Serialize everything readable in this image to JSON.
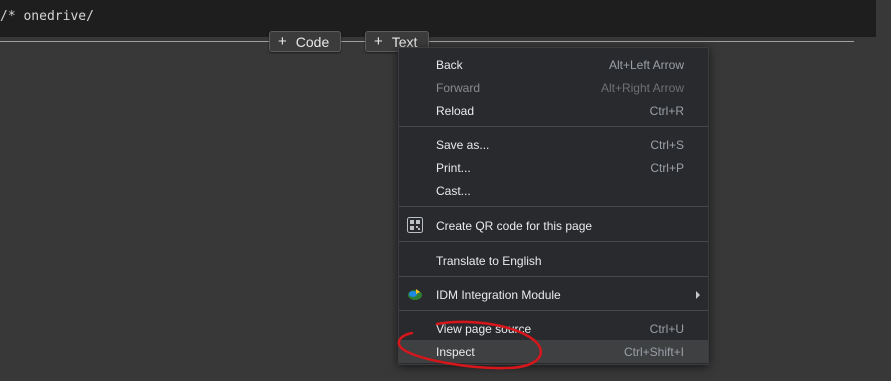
{
  "code_cell": {
    "text": "/* onedrive/"
  },
  "add_cell": {
    "code_label": "Code",
    "text_label": "Text",
    "plus_symbol": "+"
  },
  "context_menu": {
    "back": {
      "label": "Back",
      "shortcut": "Alt+Left Arrow"
    },
    "forward": {
      "label": "Forward",
      "shortcut": "Alt+Right Arrow",
      "disabled": true
    },
    "reload": {
      "label": "Reload",
      "shortcut": "Ctrl+R"
    },
    "save_as": {
      "label": "Save as...",
      "shortcut": "Ctrl+S"
    },
    "print": {
      "label": "Print...",
      "shortcut": "Ctrl+P"
    },
    "cast": {
      "label": "Cast..."
    },
    "qr_code": {
      "label": "Create QR code for this page",
      "icon": "qr-code-icon"
    },
    "translate": {
      "label": "Translate to English"
    },
    "idm": {
      "label": "IDM Integration Module",
      "icon": "idm-icon",
      "submenu_icon": "chevron-right-icon"
    },
    "view_source": {
      "label": "View page source",
      "shortcut": "Ctrl+U"
    },
    "inspect": {
      "label": "Inspect",
      "shortcut": "Ctrl+Shift+I",
      "highlighted": true
    }
  },
  "colors": {
    "background": "#383838",
    "menu_background": "#292a2d",
    "annotation_red": "#d6161b"
  }
}
